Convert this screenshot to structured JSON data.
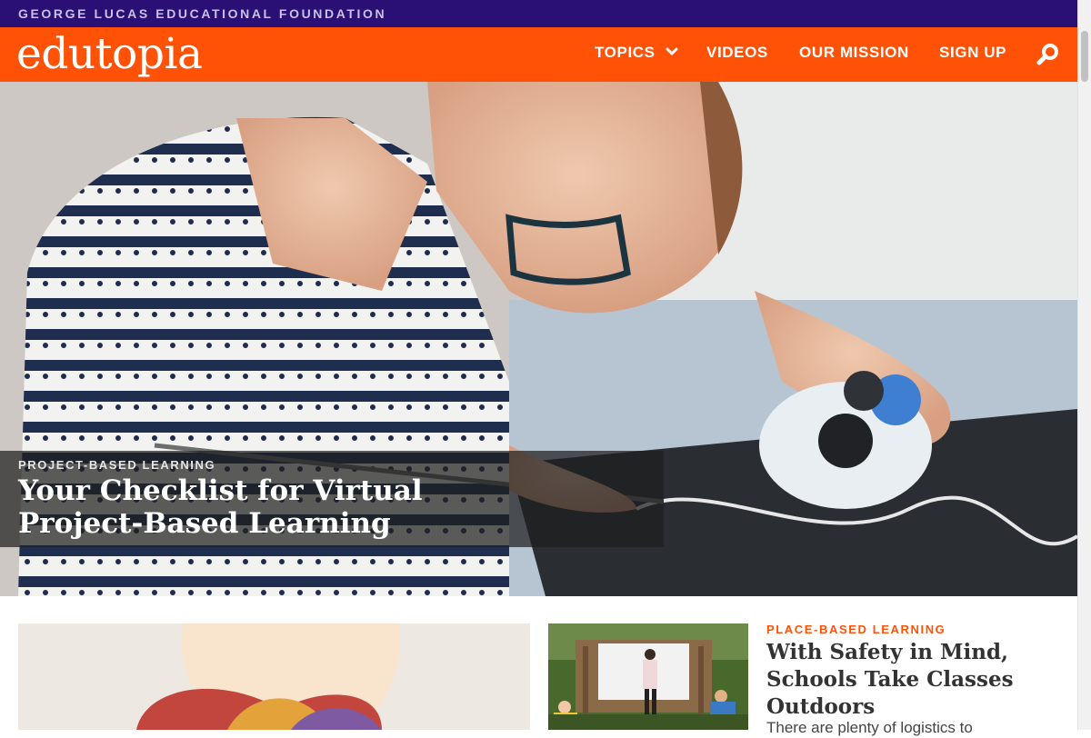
{
  "top_bar": {
    "text": "GEORGE LUCAS EDUCATIONAL FOUNDATION"
  },
  "header": {
    "logo": "edutopia",
    "nav": {
      "topics": "TOPICS",
      "videos": "VIDEOS",
      "mission": "OUR MISSION",
      "signup": "SIGN UP"
    }
  },
  "hero": {
    "kicker": "PROJECT-BASED LEARNING",
    "title": "Your Checklist for Virtual Project-Based Learning"
  },
  "feature": {
    "kicker": "PLACE-BASED LEARNING",
    "title": "With Safety in Mind, Schools Take Classes Outdoors",
    "description": "There are plenty of logistics to"
  },
  "colors": {
    "top_bar": "#2a0f74",
    "brand_orange": "#ff5206"
  }
}
